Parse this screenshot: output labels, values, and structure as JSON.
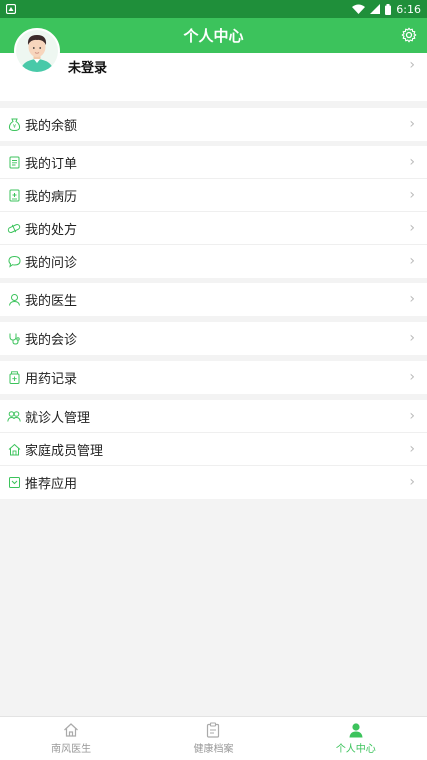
{
  "status_bar": {
    "time": "6:16"
  },
  "header": {
    "title": "个人中心"
  },
  "profile": {
    "login_label": "未登录"
  },
  "menu": {
    "balance": "我的余额",
    "orders": "我的订单",
    "records": "我的病历",
    "prescriptions": "我的处方",
    "consults": "我的问诊",
    "doctors": "我的医生",
    "consultations": "我的会诊",
    "medication": "用药记录",
    "patients": "就诊人管理",
    "family": "家庭成员管理",
    "recommend": "推荐应用"
  },
  "tabs": [
    {
      "label": "南风医生",
      "icon": "home-icon",
      "active": false
    },
    {
      "label": "健康档案",
      "icon": "clipboard-icon",
      "active": false
    },
    {
      "label": "个人中心",
      "icon": "person-icon",
      "active": true
    }
  ],
  "colors": {
    "accent": "#3cc35c",
    "status_bar": "#1f8f3a",
    "background": "#f3f3f3"
  }
}
